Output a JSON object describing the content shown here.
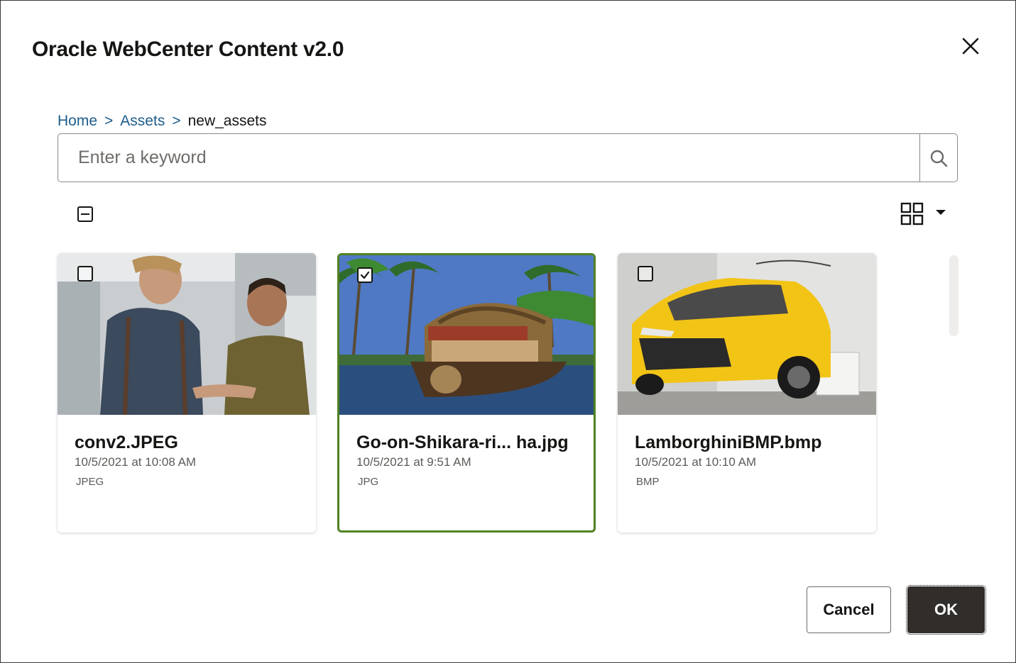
{
  "dialog": {
    "title": "Oracle WebCenter Content v2.0"
  },
  "breadcrumb": {
    "items": [
      {
        "label": "Home",
        "link": true
      },
      {
        "label": "Assets",
        "link": true
      },
      {
        "label": "new_assets",
        "link": false
      }
    ],
    "separator": ">"
  },
  "search": {
    "placeholder": "Enter a keyword",
    "value": ""
  },
  "toolbar": {
    "select_all_state": "indeterminate",
    "view_mode_icon": "grid-view-icon"
  },
  "assets": [
    {
      "name": "conv2.JPEG",
      "date": "10/5/2021 at 10:08 AM",
      "type": "JPEG",
      "selected": false
    },
    {
      "name": "Go-on-Shikara-ri...  ha.jpg",
      "date": "10/5/2021 at 9:51 AM",
      "type": "JPG",
      "selected": true
    },
    {
      "name": "LamborghiniBMP.bmp",
      "date": "10/5/2021 at 10:10 AM",
      "type": "BMP",
      "selected": false
    }
  ],
  "actions": {
    "cancel_label": "Cancel",
    "ok_label": "OK"
  },
  "colors": {
    "link": "#1d5d8c",
    "selected_border": "#508223",
    "primary_button": "#312d2a"
  }
}
